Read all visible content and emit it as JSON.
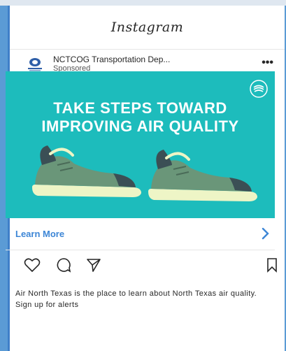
{
  "app": {
    "logo": "Instagram"
  },
  "post": {
    "account_name": "NCTCOG Transportation Dep...",
    "sponsored": "Sponsored",
    "more": "•••"
  },
  "ad": {
    "headline_line1": "TAKE STEPS TOWARD",
    "headline_line2": "IMPROVING AIR QUALITY",
    "background_color": "#1dbcbc",
    "badge_icon": "air-north-texas-logo-icon",
    "shoe_icon": "sneaker-icon"
  },
  "cta": {
    "label": "Learn More",
    "color": "#3d86d6",
    "arrow_icon": "chevron-right-icon"
  },
  "actions": {
    "icons": [
      "heart-icon",
      "comment-icon",
      "share-icon",
      "bookmark-icon"
    ]
  },
  "caption": {
    "text": "Air North Texas is the place to learn about North Texas air quality. Sign up for alerts"
  }
}
